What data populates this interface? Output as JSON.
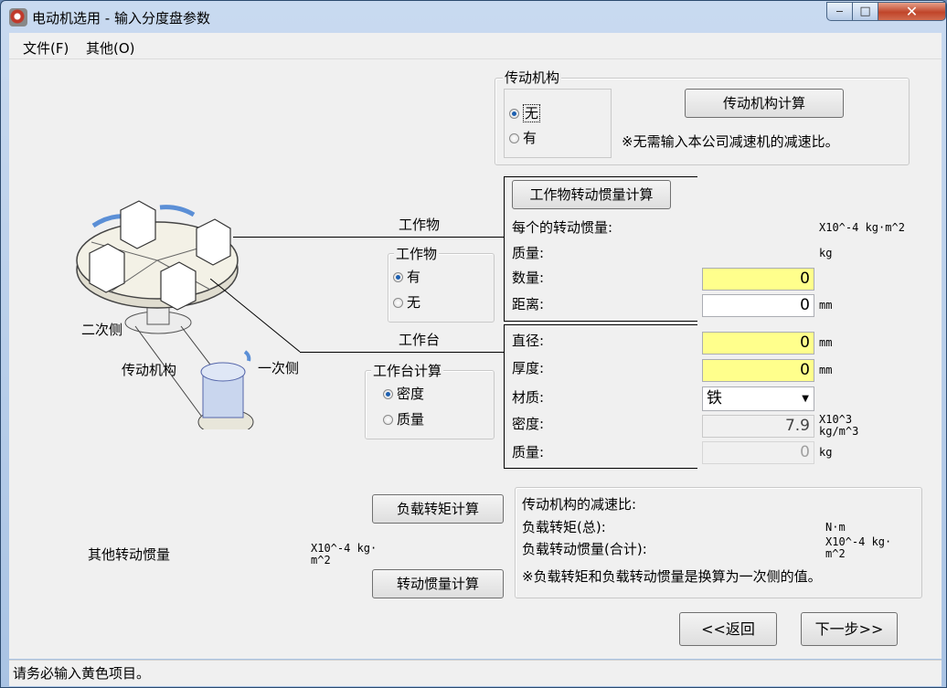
{
  "window": {
    "title": "电动机选用 - 输入分度盘参数",
    "min": "‒",
    "max": "□",
    "close": "✕"
  },
  "menu": {
    "file": "文件(F)",
    "other": "其他(O)"
  },
  "mechanism": {
    "legend": "传动机构",
    "opt_none": "无",
    "opt_yes": "有",
    "selected": "无",
    "calc_button": "传动机构计算",
    "note": "※无需输入本公司减速机的减速比。"
  },
  "diagram": {
    "secondary": "二次侧",
    "mechanism": "传动机构",
    "primary": "一次侧"
  },
  "workpiece": {
    "label": "工作物",
    "legend": "工作物",
    "opt_yes": "有",
    "opt_no": "无",
    "selected": "有",
    "calc_button": "工作物转动惯量计算",
    "inertia_label": "每个的转动惯量:",
    "inertia_unit": "X10^-4 kg·m^2",
    "mass_label": "质量:",
    "mass_unit": "kg",
    "count_label": "数量:",
    "count_value": "0",
    "distance_label": "距离:",
    "distance_value": "0",
    "distance_unit": "mm"
  },
  "table": {
    "label": "工作台",
    "legend": "工作台计算",
    "opt_density": "密度",
    "opt_mass": "质量",
    "selected": "密度",
    "diameter_label": "直径:",
    "diameter_value": "0",
    "diameter_unit": "mm",
    "thickness_label": "厚度:",
    "thickness_value": "0",
    "thickness_unit": "mm",
    "material_label": "材质:",
    "material_value": "铁",
    "density_label": "密度:",
    "density_value": "7.9",
    "density_unit_1": "X10^3",
    "density_unit_2": "kg/m^3",
    "mass_label": "质量:",
    "mass_value": "0",
    "mass_unit": "kg"
  },
  "load": {
    "torque_button": "负载转矩计算",
    "inertia_button": "转动惯量计算",
    "other_inertia_label": "其他转动惯量",
    "other_inertia_unit_1": "X10^-4 kg·",
    "other_inertia_unit_2": "m^2",
    "ratio_label": "传动机构的减速比:",
    "torque_label": "负载转矩(总):",
    "torque_unit": "N·m",
    "inertia_label": "负载转动惯量(合计):",
    "inertia_unit_1": "X10^-4 kg·",
    "inertia_unit_2": "m^2",
    "note": "※负载转矩和负载转动惯量是换算为一次侧的值。"
  },
  "nav": {
    "back": "<<返回",
    "next": "下一步>>"
  },
  "status": "请务必输入黄色项目。",
  "colors": {
    "required_field": "#ffff8c",
    "window_frame": "#a9c3e4"
  }
}
